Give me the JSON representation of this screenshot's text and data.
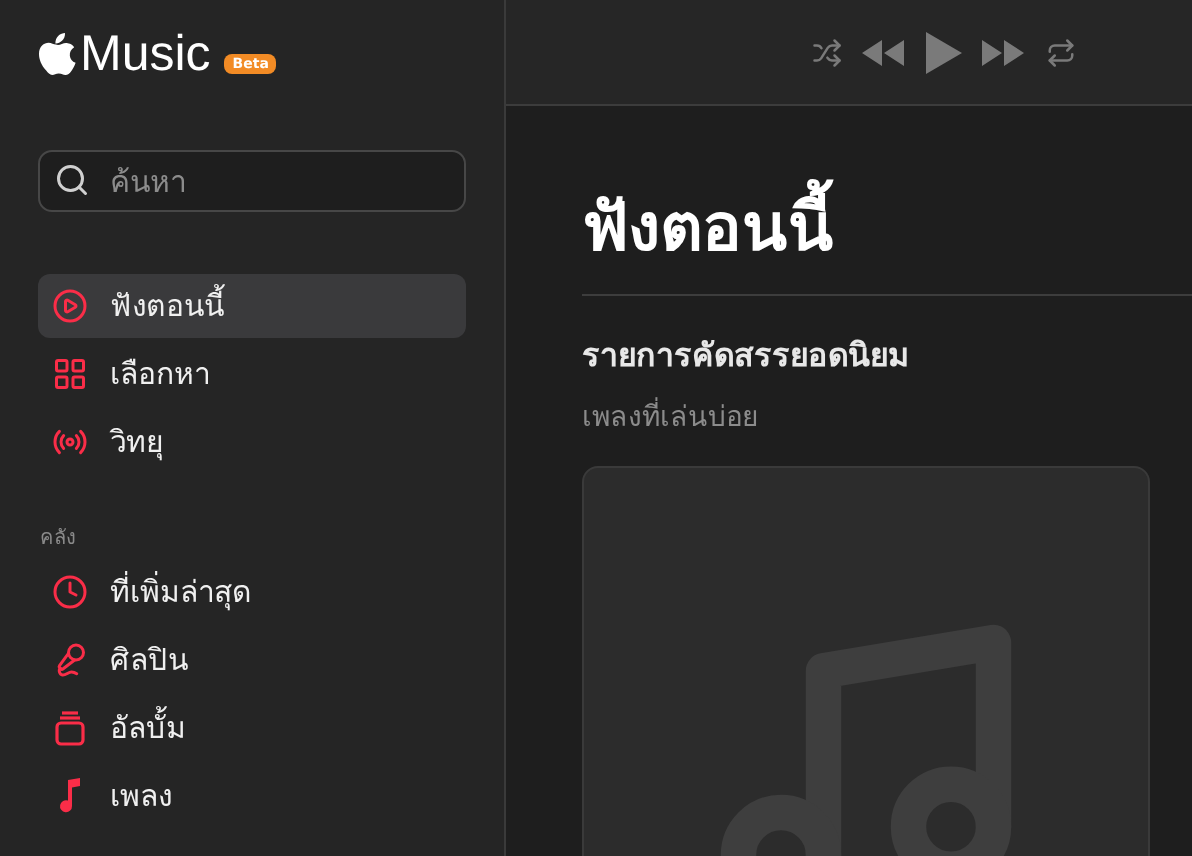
{
  "app": {
    "name": "Music",
    "badge": "Beta"
  },
  "search": {
    "placeholder": "ค้นหา"
  },
  "sidebar": {
    "items": [
      {
        "label": "ฟังตอนนี้",
        "selected": true
      },
      {
        "label": "เลือกหา",
        "selected": false
      },
      {
        "label": "วิทยุ",
        "selected": false
      }
    ],
    "library": {
      "title": "คลัง",
      "items": [
        {
          "label": "ที่เพิ่มล่าสุด",
          "selected": false
        },
        {
          "label": "ศิลปิน",
          "selected": false
        },
        {
          "label": "อัลบั้ม",
          "selected": false
        },
        {
          "label": "เพลง",
          "selected": false
        }
      ]
    }
  },
  "page": {
    "title": "ฟังตอนนี้",
    "section": {
      "title": "รายการคัดสรรยอดนิยม",
      "subtitle": "เพลงที่เล่นบ่อย"
    }
  }
}
